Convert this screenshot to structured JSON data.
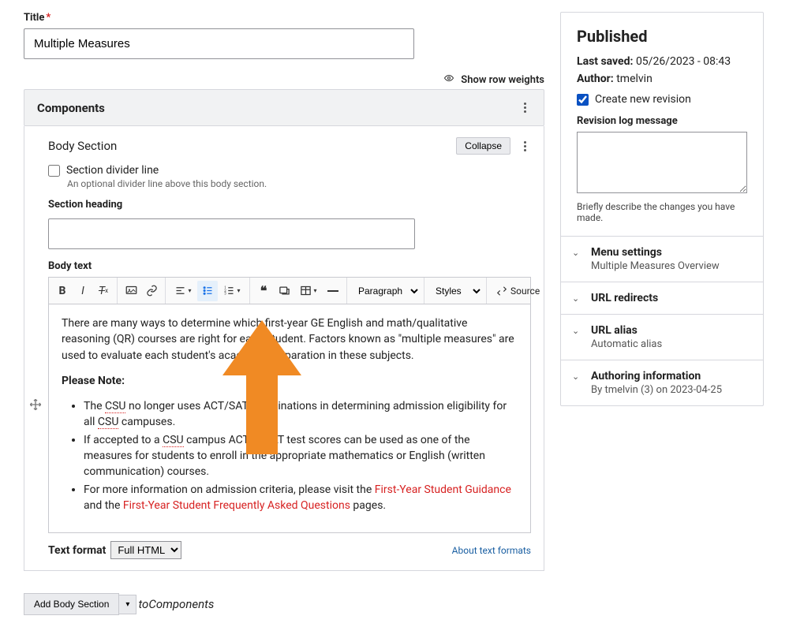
{
  "title": {
    "label": "Title",
    "value": "Multiple Measures"
  },
  "row_weights": "Show row weights",
  "components": {
    "header": "Components",
    "body_section_label": "Body Section",
    "collapse": "Collapse",
    "divider_label": "Section divider line",
    "divider_desc": "An optional divider line above this body section.",
    "section_heading_label": "Section heading",
    "body_text_label": "Body text",
    "paragraph_option": "Paragraph",
    "styles_option": "Styles",
    "source_label": "Source",
    "body": {
      "p1": "There are many ways to determine which first-year GE English and math/qualitative reasoning (QR) courses are right for each student. Factors known as \"multiple measures\" are used to evaluate each student's academic preparation in these subjects.",
      "note_label": "Please Note:",
      "li1_a": "The ",
      "li1_csu": "CSU",
      "li1_b": " no longer uses ACT/SAT examinations in determining admission eligibility for all ",
      "li1_csu2": "CSU",
      "li1_c": " campuses.",
      "li2_a": "If accepted to a ",
      "li2_csu": "CSU",
      "li2_b": " campus ACT or SAT test scores can be used as one of the measures for students to enroll in the appropriate mathematics or English (written communication) courses.",
      "li3_a": "For more information on admission criteria, please visit the ",
      "li3_link1": "First-Year Student Guidance",
      "li3_b": " and the ",
      "li3_link2": "First-Year Student Frequently Asked Questions",
      "li3_c": " pages."
    },
    "text_format_label": "Text format",
    "text_format_value": "Full HTML",
    "about_formats": "About text formats",
    "add_body_section": "Add Body Section",
    "to_components": "toComponents"
  },
  "sidebar": {
    "published": "Published",
    "last_saved_label": "Last saved:",
    "last_saved_value": "05/26/2023 - 08:43",
    "author_label": "Author:",
    "author_value": "tmelvin",
    "create_revision": "Create new revision",
    "revision_log_label": "Revision log message",
    "revision_desc": "Briefly describe the changes you have made.",
    "accordions": [
      {
        "title": "Menu settings",
        "sub": "Multiple Measures Overview"
      },
      {
        "title": "URL redirects",
        "sub": ""
      },
      {
        "title": "URL alias",
        "sub": "Automatic alias"
      },
      {
        "title": "Authoring information",
        "sub": "By tmelvin (3) on 2023-04-25"
      }
    ]
  }
}
